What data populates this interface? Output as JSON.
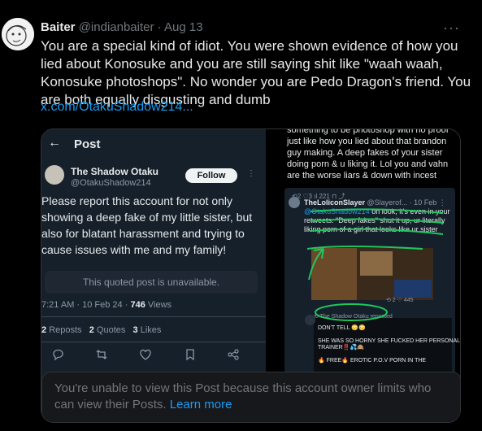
{
  "tweet": {
    "author_name": "Baiter",
    "handle": "@indianbaiter",
    "separator": "·",
    "date": "Aug 13",
    "more_label": "···",
    "text": "You are a special kind of idiot. You were shown evidence of how you lied about Konosuke and you are still saying shit like \"waah waah, Konosuke photoshops\". No wonder you are Pedo Dragon's friend. You are both equally disgusting and dumb",
    "link": "x.com/OtakuShadow214..."
  },
  "left_screenshot": {
    "back_icon": "←",
    "post_title": "Post",
    "author_name": "The Shadow Otaku",
    "handle": "@OtakuShadow214",
    "follow_label": "Follow",
    "more_label": "⋮",
    "text": "Please report this account for not only showing a deep fake of my little sister, but also for blatant harassment and trying to cause issues with me and my family!",
    "unavailable": "This quoted post is unavailable.",
    "time": "7:21 AM · 10 Feb 24 · ",
    "views_count": "746",
    "views_label": " Views",
    "reposts_count": "2",
    "reposts_label": "Reposts",
    "quotes_count": "2",
    "quotes_label": "Quotes",
    "likes_count": "3",
    "likes_label": "Likes"
  },
  "right_screenshot": {
    "top_text": "something to be photoshop with no proof just like how you lied about that brandon guy making. A deep fakes of your sister doing porn & u liking it. Lol you and vahn are the worse liars & down with incest",
    "icon_row": "⟲2    ♡3    ıl 221    ⊓    ⤴",
    "inner_name": "TheLoliconSlayer",
    "inner_meta": " @Slayerof... · 10 Feb ⋮",
    "mention": "@OtakuShadow214",
    "inner_text": " oh look, it's even in your retweets. \"Deep fakes\" shut it up, ur literally liking porn of a girl that looks like ur sister",
    "stats_row": "⟲ 2   ♡ 445",
    "repost_line": "⟲ The Shadow Otaku reposted",
    "dont_tell": "DON'T TELL 😳😳",
    "snippet1": "SHE WAS SO HORNY SHE FUCKED HER PERSONAL TRAINER‼️💦🙈",
    "snippet2": "🔥 FREE🔥 EROTIC P.O.V PORN IN THE"
  },
  "notice": {
    "text": "You're unable to view this Post because this account owner limits who can view their Posts. ",
    "link": "Learn more"
  },
  "colors": {
    "accent": "#1d9bf0",
    "muted": "#71767b",
    "annotation": "#22c55e"
  }
}
